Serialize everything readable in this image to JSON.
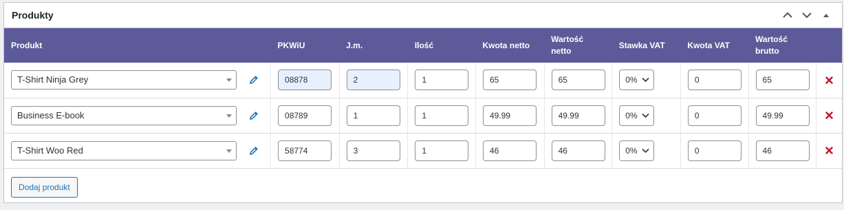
{
  "panel": {
    "title": "Produkty",
    "controls": [
      "chevron-up",
      "chevron-down",
      "triangle-up"
    ]
  },
  "columns": {
    "produkt": "Produkt",
    "pkwiu": "PKWiU",
    "jm": "J.m.",
    "ilosc": "Ilość",
    "kwota_netto": "Kwota netto",
    "wartosc_netto": "Wartość netto",
    "stawka_vat": "Stawka VAT",
    "kwota_vat": "Kwota VAT",
    "wartosc_brutto": "Wartość brutto"
  },
  "rows": [
    {
      "product": "T-Shirt Ninja Grey",
      "pkwiu": "08878",
      "jm": "2",
      "ilosc": "1",
      "kwota_netto": "65",
      "wartosc_netto": "65",
      "stawka_vat": "0%",
      "kwota_vat": "0",
      "wartosc_brutto": "65",
      "autofilled": true
    },
    {
      "product": "Business E-book",
      "pkwiu": "08789",
      "jm": "1",
      "ilosc": "1",
      "kwota_netto": "49.99",
      "wartosc_netto": "49.99",
      "stawka_vat": "0%",
      "kwota_vat": "0",
      "wartosc_brutto": "49.99",
      "autofilled": false
    },
    {
      "product": "T-Shirt Woo Red",
      "pkwiu": "58774",
      "jm": "3",
      "ilosc": "1",
      "kwota_netto": "46",
      "wartosc_netto": "46",
      "stawka_vat": "0%",
      "kwota_vat": "0",
      "wartosc_brutto": "46",
      "autofilled": false
    }
  ],
  "footer": {
    "add_button": "Dodaj produkt"
  },
  "colors": {
    "header_bg": "#5d5a9a",
    "accent": "#2271b1",
    "delete": "#c0142c",
    "autofill_bg": "#e8f0fe"
  },
  "icons": {
    "edit": "pencil-icon",
    "delete": "close-x-icon",
    "dropdown": "chevron-down-icon"
  }
}
